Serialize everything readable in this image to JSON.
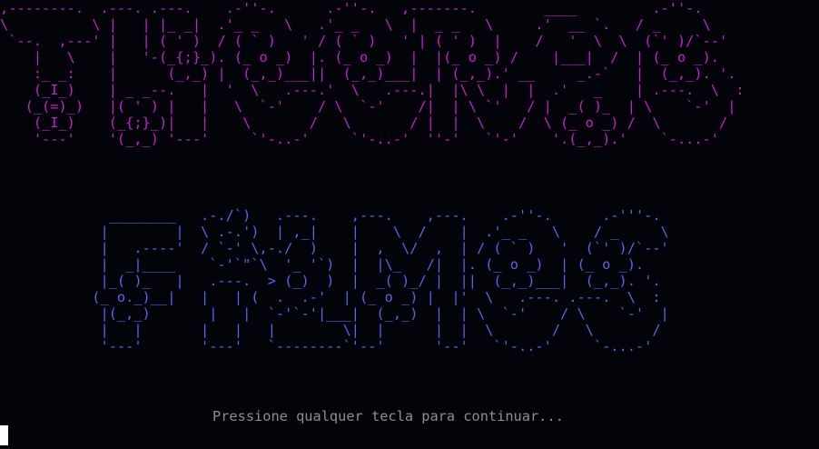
{
  "terminal": {
    "background": "#03040a",
    "banner_top": {
      "lines": [
        ",--------.  .---. .---.    .-''-.      .-''-.   ,-------.        ____         .-''-.",
        "\\          \\ |   | |_ _|  .'_ _   \\   .'_ _   \\  |  _ _   \\     .'  __ `.   / _     \\",
        " `--.  ,---' |   | ( ' )  / ( ` )   ' / ( ` )   ' | ( ' )  |    /   '  \\  \\  (`' )/`--'",
        "    |   \\    |   '-(_{;}_). (_ o _)  |. (_ o _)  |  |(_ o _) /    |___|  /  | (_ o _).",
        "    :_ _:    |      (_,_) |  (_,_)___||  (_,_)___|  | (_,_).' __     _.-`   |  (_,_). '.",
        "    (_I_)    | _ _--.   |  '  \\   .---.'  \\   .---.|  |\\ \\  |  |  .'   _    | .---.  \\  :",
        "   (_(=)_)   |( ' ) |   |   \\  `-'    / \\  `-'    /|  | \\ `'   / |  _( )_  | \\    `-'  |",
        "    (_I_)    (_{;}_)|   |    \\       /   \\       / |  |  \\    /  \\ (_ o _) /  \\       /",
        "    '---'    '(_,_) '---'     `'-..-'     `'-..-'  ''-'   `'-'    '.(_,_).'    `-...-'"
      ],
      "color": "#c81ecf"
    },
    "banner_bottom": {
      "lines": [
        "             ________   .-./`)   .---.    ,---.    ,---.    .-''-.      .-'''-.",
        "            |        |  \\ .-.')  | ,_|    |    \\  /    |  .'_ _   \\    / _     \\",
        "            |   .----'  / `-' \\,-./  )    |  ,  \\/  ,  | / ( ` )   '  (`' )/`--'",
        "            |  _|____    `-'`\"`\\  '_ '`)  |  |\\_   /|  |. (_ o _)  | (_ o _).",
        "            |_( )_   |   .---.  > (_)  )  |  _( )_/ |  ||  (_,_)___|  (_,_). '.",
        "           (_ o._)__|   |   | (  .  .-'  | (_ o _) |  |'  \\   .---. .---.  \\  :",
        "            |(_,_)       |   |  `-'`-'|___|  (_,_)  |  | \\  `-'    / \\    `-'  |",
        "            |   |       |   |   |        \\|  |      |  |  \\       /   \\       /",
        "            '---'       '---'   `--------`'--'      '--'   `'-..-'     `-...-'"
      ],
      "color": "#5a63f0"
    },
    "prompt": {
      "text": "Pressione qualquer tecla para continuar...",
      "color": "#8e8e8e"
    },
    "cursor": {
      "color": "#ffffff"
    }
  }
}
